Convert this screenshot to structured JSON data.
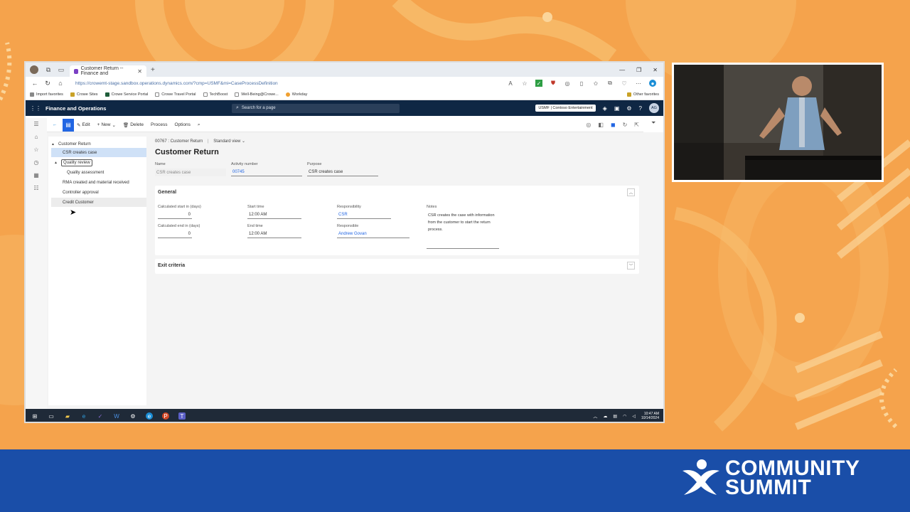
{
  "browser": {
    "tab_title": "Customer Return -- Finance and",
    "url": "https://crowemt-stage.sandbox.operations.dynamics.com/?cmp=USMF&mi=CaseProcessDefinition",
    "favorites": [
      "Import favorites",
      "Crowe Sites",
      "Crowe Service Portal",
      "Crowe Travel Portal",
      "TechBoost",
      "Well-Being@Crowe...",
      "Workday"
    ],
    "other_favorites": "Other favorites"
  },
  "app": {
    "title": "Finance and Operations",
    "search_placeholder": "Search for a page",
    "company": "USMF | Contoso Entertainment",
    "user_initials": "AG"
  },
  "action_pane": {
    "edit": "Edit",
    "new": "New",
    "delete": "Delete",
    "process": "Process",
    "options": "Options"
  },
  "tree": {
    "root": "Customer Return",
    "items": [
      {
        "label": "CSR creates case"
      },
      {
        "label": "Quality review"
      },
      {
        "label": "Quality assessment"
      },
      {
        "label": "RMA created and material received"
      },
      {
        "label": "Controller approval"
      },
      {
        "label": "Credit Customer"
      }
    ]
  },
  "form": {
    "breadcrumb": "00767 : Customer Return",
    "view": "Standard view",
    "title": "Customer Return",
    "name_label": "Name",
    "name_value": "CSR creates case",
    "activity_label": "Activity number",
    "activity_value": "00745",
    "purpose_label": "Purpose",
    "purpose_value": "CSR creates case",
    "general": {
      "title": "General",
      "calc_start_label": "Calculated start in (days)",
      "calc_start_value": "0",
      "calc_end_label": "Calculated end in (days)",
      "calc_end_value": "0",
      "start_time_label": "Start time",
      "start_time_value": "12:00 AM",
      "end_time_label": "End time",
      "end_time_value": "12:00 AM",
      "responsibility_label": "Responsibility",
      "responsibility_value": "CSR",
      "responsible_label": "Responsible",
      "responsible_value": "Andrew Govan",
      "notes_label": "Notes",
      "notes_value": "CSR creates the case with information from the customer to start the return process."
    },
    "exit_criteria_title": "Exit criteria"
  },
  "taskbar": {
    "time": "10:47 AM",
    "date": "10/14/2024"
  },
  "banner": {
    "line1": "COMMUNITY",
    "line2": "SUMMIT"
  }
}
